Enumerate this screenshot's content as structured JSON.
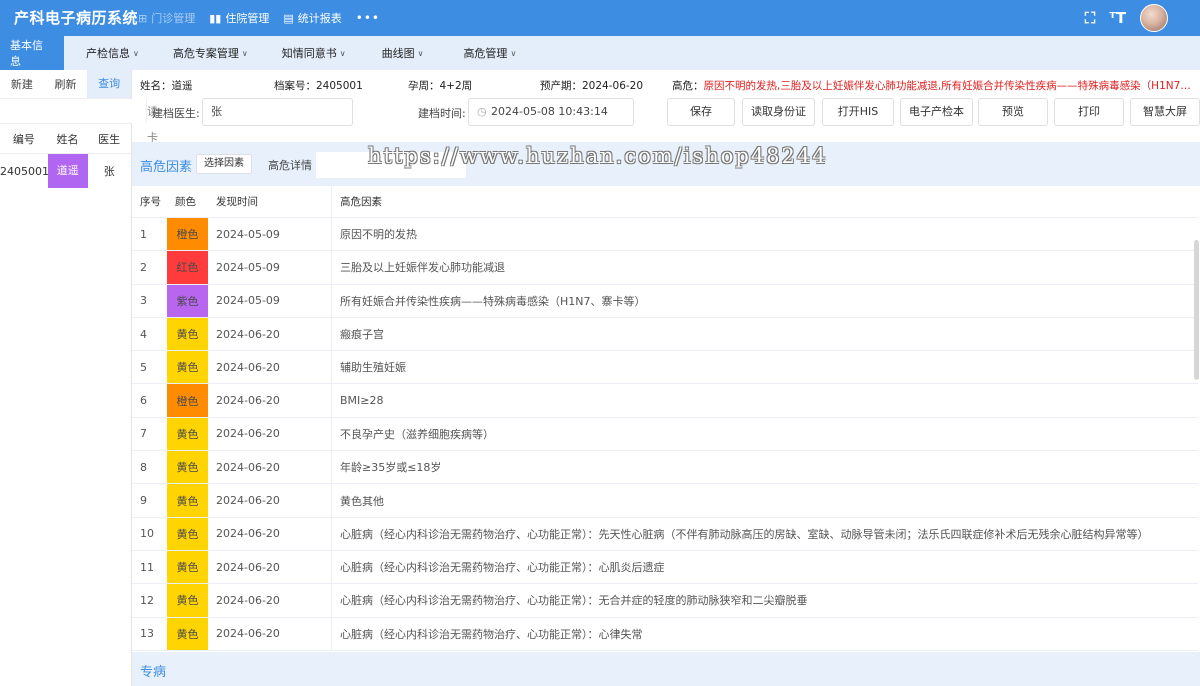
{
  "app": {
    "title": "产科电子病历系统"
  },
  "topnav": [
    {
      "icon": "⊞",
      "label": "门诊管理",
      "active": true
    },
    {
      "icon": "▮▮",
      "label": "住院管理"
    },
    {
      "icon": "▤",
      "label": "统计报表"
    }
  ],
  "topnav_more": "•••",
  "top_right": {
    "fullscreen_icon": "⛶",
    "font_icon": "ᵀT"
  },
  "subnav": [
    {
      "label": "基本信息",
      "active": true
    },
    {
      "label": "产检信息",
      "caret": "∨"
    },
    {
      "label": "高危专案管理",
      "caret": "∨"
    },
    {
      "label": "知情同意书",
      "caret": "∨"
    },
    {
      "label": "曲线图",
      "caret": "∨"
    },
    {
      "label": "高危管理",
      "caret": "∨"
    }
  ],
  "left_panel": {
    "actions": [
      "新建",
      "刷新",
      "查询"
    ],
    "read_card": "读卡",
    "search_value": "",
    "columns": [
      "编号",
      "姓名",
      "医生"
    ],
    "rows": [
      {
        "id": "2405001",
        "name": "道遥",
        "doctor": "张",
        "name_color": "#b066f0"
      }
    ]
  },
  "patient": {
    "name_label": "姓名：",
    "name": "道遥",
    "file_label": "档案号：",
    "file_no": "2405001",
    "gest_label": "孕周：",
    "gest": "4+2周",
    "edd_label": "预产期：",
    "edd": "2024-06-20",
    "risk_label": "高危：",
    "risk_text": "原因不明的发热,三胎及以上妊娠伴发心肺功能减退,所有妊娠合并传染性疾病——特殊病毒感染（H1N7…"
  },
  "form": {
    "doctor_label": "建档医生:",
    "doctor_value": "张",
    "time_label": "建档时间:",
    "time_value": "2024-05-08 10:43:14",
    "buttons": [
      "保存",
      "读取身份证",
      "打开HIS",
      "电子产检本",
      "预览",
      "打印",
      "智慧大屏"
    ]
  },
  "risk_section": {
    "title": "高危因素",
    "select_button": "选择因素",
    "detail_label": "高危详情",
    "columns": [
      "序号",
      "颜色",
      "发现时间",
      "高危因素"
    ],
    "rows": [
      {
        "no": "1",
        "color": "橙色",
        "hex": "#ff8c00",
        "date": "2024-05-09",
        "factor": "原因不明的发热"
      },
      {
        "no": "2",
        "color": "红色",
        "hex": "#ff3b3b",
        "date": "2024-05-09",
        "factor": "三胎及以上妊娠伴发心肺功能减退"
      },
      {
        "no": "3",
        "color": "紫色",
        "hex": "#b866f0",
        "date": "2024-05-09",
        "factor": "所有妊娠合并传染性疾病——特殊病毒感染（H1N7、寨卡等）"
      },
      {
        "no": "4",
        "color": "黄色",
        "hex": "#ffd400",
        "date": "2024-06-20",
        "factor": "瘢痕子宫"
      },
      {
        "no": "5",
        "color": "黄色",
        "hex": "#ffd400",
        "date": "2024-06-20",
        "factor": "辅助生殖妊娠"
      },
      {
        "no": "6",
        "color": "橙色",
        "hex": "#ff8c00",
        "date": "2024-06-20",
        "factor": "BMI≥28"
      },
      {
        "no": "7",
        "color": "黄色",
        "hex": "#ffd400",
        "date": "2024-06-20",
        "factor": "不良孕产史（滋养细胞疾病等）"
      },
      {
        "no": "8",
        "color": "黄色",
        "hex": "#ffd400",
        "date": "2024-06-20",
        "factor": "年龄≥35岁或≤18岁"
      },
      {
        "no": "9",
        "color": "黄色",
        "hex": "#ffd400",
        "date": "2024-06-20",
        "factor": "黄色其他"
      },
      {
        "no": "10",
        "color": "黄色",
        "hex": "#ffd400",
        "date": "2024-06-20",
        "factor": "心脏病（经心内科诊治无需药物治疗、心功能正常）：先天性心脏病（不伴有肺动脉高压的房缺、室缺、动脉导管未闭；法乐氏四联症修补术后无残余心脏结构异常等）"
      },
      {
        "no": "11",
        "color": "黄色",
        "hex": "#ffd400",
        "date": "2024-06-20",
        "factor": "心脏病（经心内科诊治无需药物治疗、心功能正常）：心肌炎后遗症"
      },
      {
        "no": "12",
        "color": "黄色",
        "hex": "#ffd400",
        "date": "2024-06-20",
        "factor": "心脏病（经心内科诊治无需药物治疗、心功能正常）：无合并症的轻度的肺动脉狭窄和二尖瓣脱垂"
      },
      {
        "no": "13",
        "color": "黄色",
        "hex": "#ffd400",
        "date": "2024-06-20",
        "factor": "心脏病（经心内科诊治无需药物治疗、心功能正常）：心律失常"
      }
    ]
  },
  "special_section": {
    "title": "专病"
  },
  "watermark": "https://www.huzhan.com/ishop48244"
}
